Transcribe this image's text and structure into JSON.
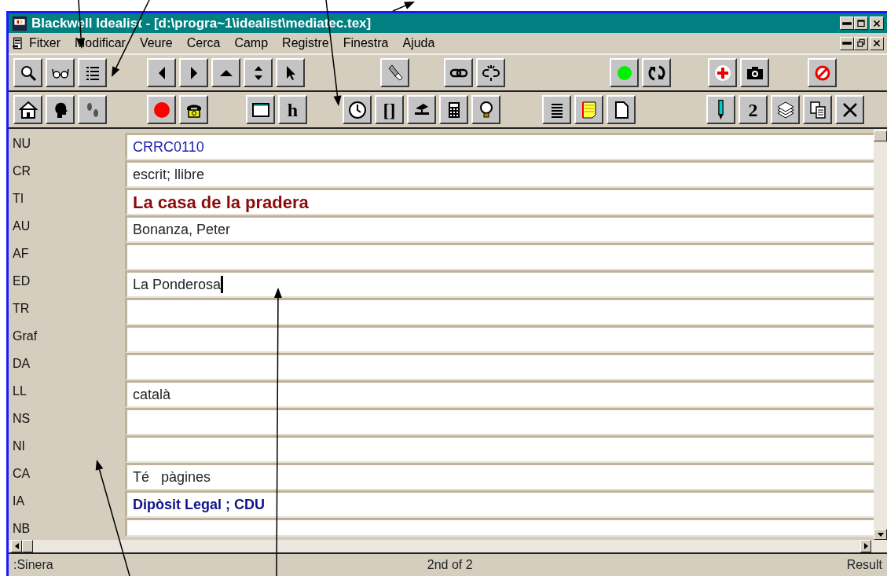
{
  "window": {
    "title": "Blackwell Idealist - [d:\\progra~1\\idealist\\mediatec.tex]"
  },
  "menu": [
    "Fitxer",
    "Modificar",
    "Veure",
    "Cerca",
    "Camp",
    "Registre",
    "Finestra",
    "Ajuda"
  ],
  "toolbars": [
    {
      "groups": [
        [
          {
            "kind": "icon"
          },
          {
            "kind": "icon"
          },
          {
            "kind": "icon"
          }
        ],
        [
          {
            "kind": "icon"
          },
          {
            "kind": "icon"
          },
          {
            "kind": "icon"
          },
          {
            "kind": "icon"
          },
          {
            "kind": "icon"
          }
        ],
        [
          {
            "kind": "icon"
          }
        ],
        [
          {
            "kind": "icon"
          },
          {
            "kind": "icon"
          }
        ],
        [
          {
            "kind": "icon"
          },
          {
            "kind": "icon"
          }
        ],
        [
          {
            "kind": "icon"
          },
          {
            "kind": "icon"
          }
        ],
        [
          {
            "kind": "icon"
          }
        ]
      ]
    },
    {
      "groups": [
        [
          {
            "kind": "icon"
          },
          {
            "kind": "icon"
          },
          {
            "kind": "icon"
          }
        ],
        [
          {
            "kind": "icon"
          },
          {
            "kind": "icon"
          }
        ],
        [
          {
            "kind": "icon"
          },
          {
            "kind": "text",
            "label": "h"
          }
        ],
        [
          {
            "kind": "icon"
          },
          {
            "kind": "text",
            "label": "[]"
          },
          {
            "kind": "icon"
          },
          {
            "kind": "icon"
          },
          {
            "kind": "icon"
          }
        ],
        [
          {
            "kind": "icon"
          },
          {
            "kind": "icon"
          },
          {
            "kind": "icon"
          }
        ],
        [
          {
            "kind": "icon"
          },
          {
            "kind": "text",
            "label": "2"
          },
          {
            "kind": "icon"
          },
          {
            "kind": "icon"
          },
          {
            "kind": "icon"
          }
        ]
      ]
    }
  ],
  "fields": [
    {
      "label": "NU",
      "value": "CRRC0110",
      "kind": "number",
      "focused": false
    },
    {
      "label": "CR",
      "value": "escrit; llibre",
      "kind": "plain",
      "focused": false
    },
    {
      "label": "TI",
      "value": "La casa de la pradera",
      "kind": "title",
      "focused": false
    },
    {
      "label": "AU",
      "value": "Bonanza, Peter",
      "kind": "plain",
      "focused": false
    },
    {
      "label": "AF",
      "kind": "plain",
      "focused": false
    },
    {
      "label": "ED",
      "value": "La Ponderosa",
      "kind": "plain",
      "focused": true
    },
    {
      "label": "TR",
      "kind": "plain",
      "focused": false
    },
    {
      "label": "Graf",
      "kind": "plain",
      "focused": false
    },
    {
      "label": "DA",
      "kind": "plain",
      "focused": false
    },
    {
      "label": "LL",
      "value": "català",
      "kind": "plain",
      "focused": false
    },
    {
      "label": "NS",
      "kind": "plain",
      "focused": false
    },
    {
      "label": "NI",
      "kind": "plain",
      "focused": false
    },
    {
      "label": "CA",
      "value": "Té   pàgines",
      "kind": "plain",
      "focused": false
    },
    {
      "label": "IA",
      "value": "Dipòsit Legal ; CDU",
      "kind": "emphasis",
      "focused": false
    },
    {
      "label": "NB",
      "kind": "plain",
      "focused": false
    }
  ],
  "status_bar": {
    "left": ":Sinera",
    "center": "2nd of 2",
    "right": "Result"
  },
  "annotation_arrows": [
    {
      "kind": "arrow"
    },
    {
      "kind": "arrow"
    },
    {
      "kind": "arrow"
    },
    {
      "kind": "arrow"
    },
    {
      "kind": "arrow"
    },
    {
      "kind": "arrow"
    }
  ]
}
